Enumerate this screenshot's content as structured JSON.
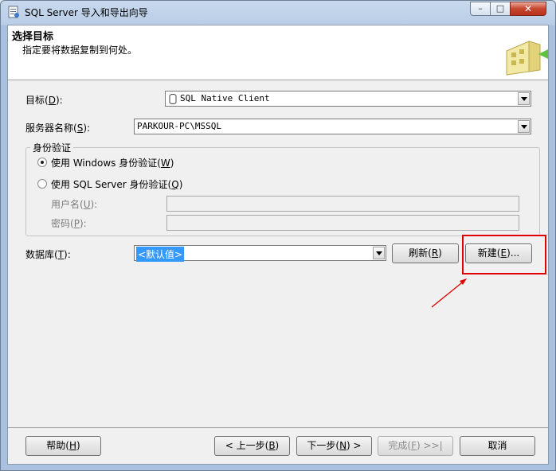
{
  "window": {
    "title": "SQL Server 导入和导出向导",
    "minimize": "–",
    "maximize": "□",
    "close": "✕"
  },
  "header": {
    "title": "选择目标",
    "subtitle": "指定要将数据复制到何处。"
  },
  "destination": {
    "label_pre": "目标(",
    "label_key": "D",
    "label_post": "):",
    "value": "SQL Native Client"
  },
  "server": {
    "label_pre": "服务器名称(",
    "label_key": "S",
    "label_post": "):",
    "value": "PARKOUR-PC\\MSSQL"
  },
  "auth": {
    "legend": "身份验证",
    "windows": {
      "pre": "使用 Windows 身份验证(",
      "key": "W",
      "post": ")",
      "checked": true
    },
    "sql": {
      "pre": "使用 SQL Server 身份验证(",
      "key": "Q",
      "post": ")",
      "checked": false
    },
    "username": {
      "pre": "用户名(",
      "key": "U",
      "post": "):",
      "value": ""
    },
    "password": {
      "pre": "密码(",
      "key": "P",
      "post": "):",
      "value": ""
    }
  },
  "database": {
    "label_pre": "数据库(",
    "label_key": "T",
    "label_post": "):",
    "value": "<默认值>",
    "refresh": {
      "pre": "刷新(",
      "key": "R",
      "post": ")"
    },
    "new": {
      "pre": "新建(",
      "key": "E",
      "post": ")..."
    }
  },
  "footer": {
    "help": {
      "pre": "帮助(",
      "key": "H",
      "post": ")"
    },
    "back": {
      "pre": "< 上一步(",
      "key": "B",
      "post": ")"
    },
    "next": {
      "pre": "下一步(",
      "key": "N",
      "post": ") >"
    },
    "finish": {
      "pre": "完成(",
      "key": "F",
      "post": ") >>|"
    },
    "cancel": "取消"
  },
  "colors": {
    "annotation": "#e00000",
    "selection": "#3399ff"
  }
}
